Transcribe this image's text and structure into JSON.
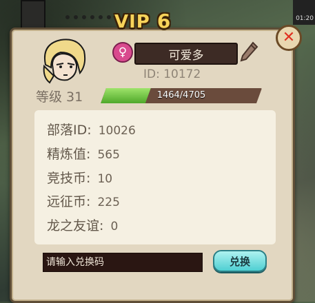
{
  "header": {
    "vip_label": "VIP",
    "vip_level": "6"
  },
  "background": {
    "time_fragment": "01:20"
  },
  "profile": {
    "name": "可爱多",
    "gender_symbol": "♀",
    "id_text": "ID: 10172",
    "level_text": "等级 31",
    "exp": {
      "current": 1464,
      "max": 4705,
      "text": "1464/4705"
    }
  },
  "stats": [
    {
      "label": "部落ID:",
      "value": "10026"
    },
    {
      "label": "精炼值:",
      "value": "565"
    },
    {
      "label": "竞技币:",
      "value": "10"
    },
    {
      "label": "远征币:",
      "value": "225"
    },
    {
      "label": "龙之友谊:",
      "value": "0"
    }
  ],
  "redeem": {
    "placeholder": "请输入兑换码",
    "button_label": "兑换"
  },
  "icons": {
    "close": "close-icon",
    "gender": "female-icon",
    "edit": "pencil-icon",
    "avatar": "character-portrait"
  },
  "colors": {
    "exp_fill": "#6fc544",
    "panel_bg": "#e2d7c1",
    "name_box": "#3d2b25",
    "button": "#7ad8dc",
    "vip_gold": "#f7d35a"
  }
}
